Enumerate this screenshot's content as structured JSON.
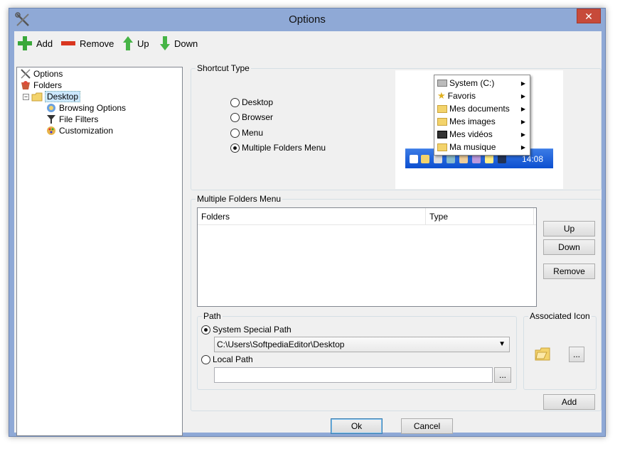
{
  "window": {
    "title": "Options",
    "close_label": "✕"
  },
  "toolbar": {
    "add": "Add",
    "remove": "Remove",
    "up": "Up",
    "down": "Down"
  },
  "tree": {
    "options": "Options",
    "folders": "Folders",
    "desktop": "Desktop",
    "browsing_options": "Browsing Options",
    "file_filters": "File Filters",
    "customization": "Customization"
  },
  "shortcut_type": {
    "label": "Shortcut Type",
    "options": [
      "Desktop",
      "Browser",
      "Menu",
      "Multiple Folders Menu"
    ],
    "selected": "Multiple Folders Menu"
  },
  "preview": {
    "menu_items": [
      "System (C:)",
      "Favoris",
      "Mes documents",
      "Mes images",
      "Mes vidéos",
      "Ma musique"
    ],
    "clock": "14:08"
  },
  "multiple_folders": {
    "label": "Multiple Folders Menu",
    "columns": [
      "Folders",
      "Type"
    ],
    "rows": [],
    "up": "Up",
    "down": "Down",
    "remove": "Remove"
  },
  "path": {
    "label": "Path",
    "system_special": "System Special Path",
    "system_value": "C:\\Users\\SoftpediaEditor\\Desktop",
    "local": "Local Path",
    "local_value": "",
    "browse": "..."
  },
  "associated_icon": {
    "label": "Associated Icon",
    "browse": "...",
    "add": "Add"
  },
  "footer": {
    "ok": "Ok",
    "cancel": "Cancel"
  }
}
